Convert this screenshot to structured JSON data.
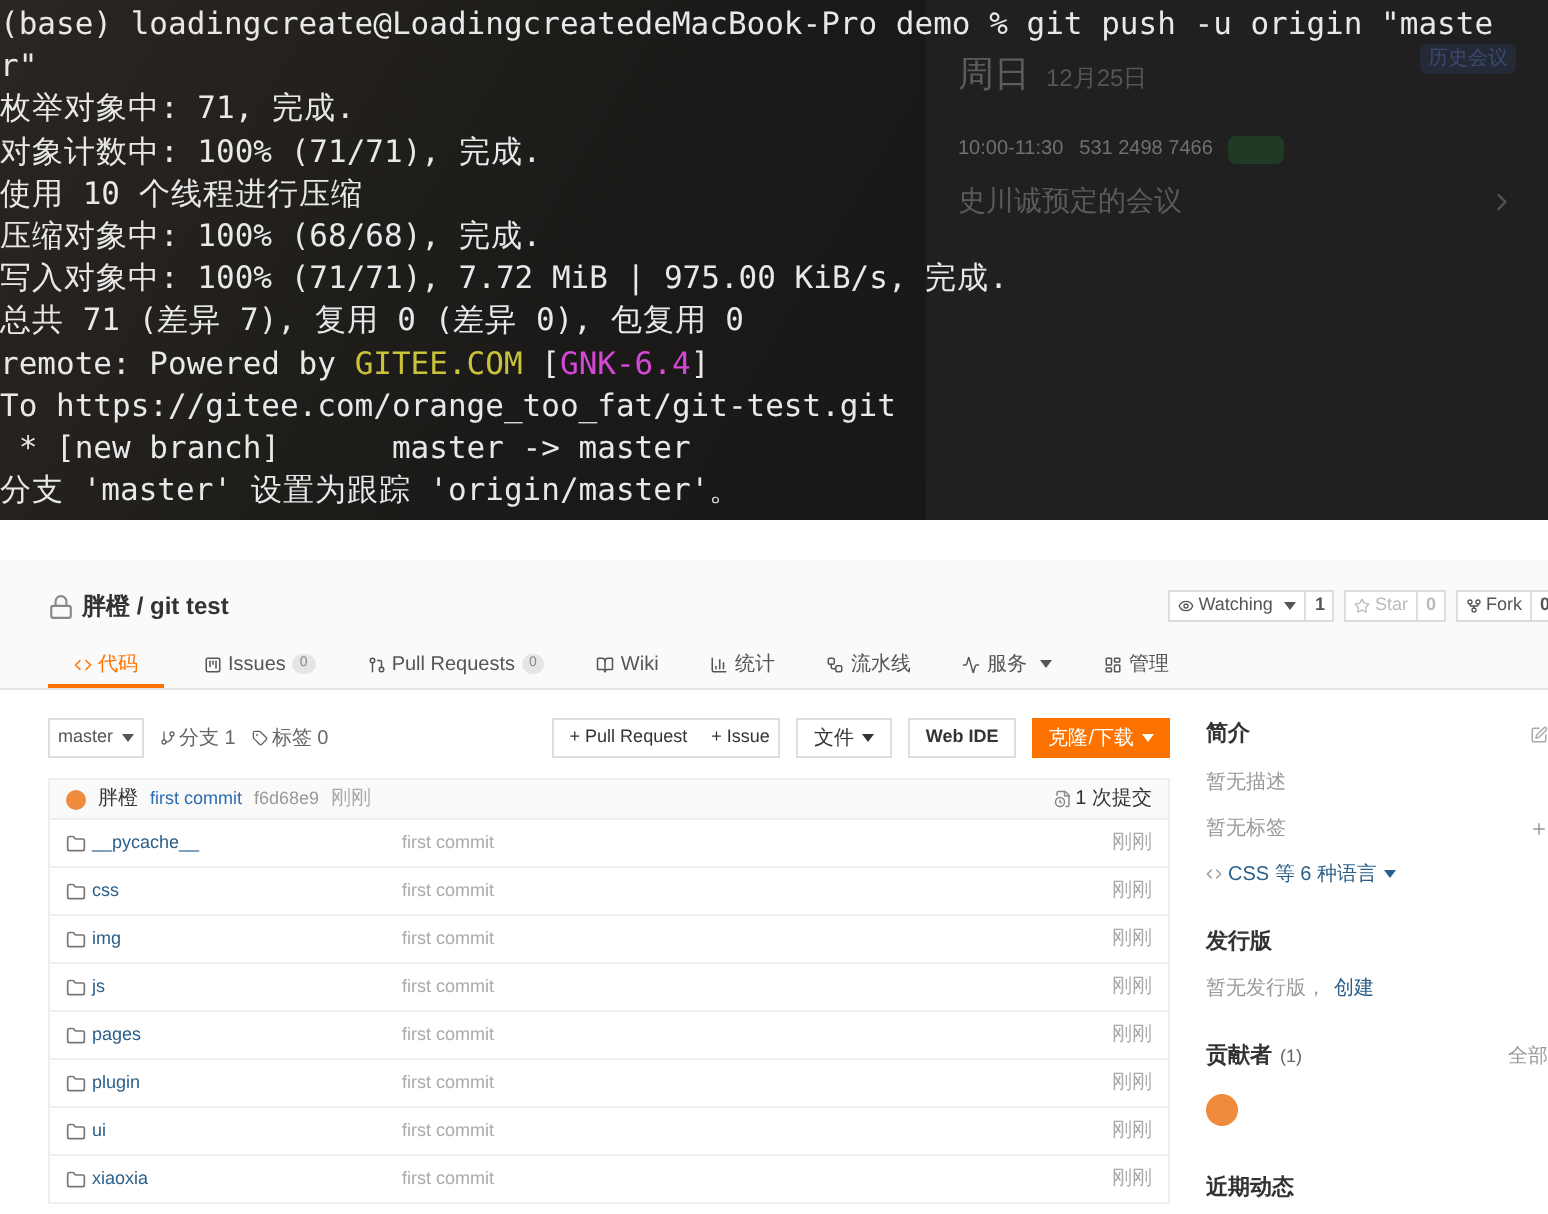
{
  "terminal": {
    "lines": [
      {
        "segments": [
          {
            "text": "(base) loadingcreate@LoadingcreatedeMacBook-Pro demo % git push -u origin \"maste",
            "color": "#e8e8e8"
          }
        ]
      },
      {
        "segments": [
          {
            "text": "r\"",
            "color": "#e8e8e8"
          }
        ]
      },
      {
        "segments": [
          {
            "text": "枚举对象中: 71, 完成.",
            "color": "#e8e8e8"
          }
        ]
      },
      {
        "segments": [
          {
            "text": "对象计数中: 100% (71/71), 完成.",
            "color": "#e8e8e8"
          }
        ]
      },
      {
        "segments": [
          {
            "text": "使用 10 个线程进行压缩",
            "color": "#e8e8e8"
          }
        ]
      },
      {
        "segments": [
          {
            "text": "压缩对象中: 100% (68/68), 完成.",
            "color": "#e8e8e8"
          }
        ]
      },
      {
        "segments": [
          {
            "text": "写入对象中: 100% (71/71), 7.72 MiB | 975.00 KiB/s, 完成.",
            "color": "#e8e8e8"
          }
        ]
      },
      {
        "segments": [
          {
            "text": "总共 71 (差异 7), 复用 0 (差异 0), 包复用 0",
            "color": "#e8e8e8"
          }
        ]
      },
      {
        "segments": [
          {
            "text": "remote: Powered by ",
            "color": "#e8e8e8"
          },
          {
            "text": "GITEE.COM",
            "color": "#c9c23a"
          },
          {
            "text": " [",
            "color": "#e8e8e8"
          },
          {
            "text": "GNK-6.4",
            "color": "#d548d5"
          },
          {
            "text": "]",
            "color": "#e8e8e8"
          }
        ]
      },
      {
        "segments": [
          {
            "text": "To https://gitee.com/orange_too_fat/git-test.git",
            "color": "#e8e8e8"
          }
        ]
      },
      {
        "segments": [
          {
            "text": " * [new branch]      master -> master",
            "color": "#e8e8e8"
          }
        ]
      },
      {
        "segments": [
          {
            "text": "分支 'master' 设置为跟踪 'origin/master'。",
            "color": "#e8e8e8"
          }
        ]
      }
    ]
  },
  "calendar_overlay": {
    "day": "周日",
    "date": "12月25日",
    "history_button": "历史会议",
    "time": "10:00-11:30",
    "meeting_id": "531 2498 7466",
    "title": "史川诚预定的会议"
  },
  "repo": {
    "title": "胖橙 / git test",
    "actions": [
      {
        "label": "Watching",
        "count": "1"
      },
      {
        "label": "Star",
        "count": "0"
      },
      {
        "label": "Fork",
        "count": "0"
      }
    ],
    "tabs": [
      {
        "label": "代码",
        "selected": true
      },
      {
        "label": "Issues",
        "count": "0",
        "selected": false
      },
      {
        "label": "Pull Requests",
        "count": "0",
        "selected": false
      },
      {
        "label": "Wiki",
        "selected": false
      },
      {
        "label": "统计",
        "selected": false
      },
      {
        "label": "流水线",
        "selected": false
      },
      {
        "label": "服务",
        "selected": false
      },
      {
        "label": "管理",
        "selected": false
      }
    ],
    "branch": "master",
    "branches": "分支 1",
    "tags": "标签 0",
    "toolbar": {
      "pull_request": "+ Pull Request",
      "issue": "+ Issue",
      "file": "文件",
      "web_ide": "Web IDE",
      "clone": "克隆/下载"
    },
    "commit": {
      "author": "胖橙",
      "message": "first commit",
      "hash": "f6d68e9",
      "time": "刚刚",
      "count": "1 次提交"
    },
    "files": [
      {
        "name": "__pycache__",
        "message": "first commit",
        "time": "刚刚"
      },
      {
        "name": "css",
        "message": "first commit",
        "time": "刚刚"
      },
      {
        "name": "img",
        "message": "first commit",
        "time": "刚刚"
      },
      {
        "name": "js",
        "message": "first commit",
        "time": "刚刚"
      },
      {
        "name": "pages",
        "message": "first commit",
        "time": "刚刚"
      },
      {
        "name": "plugin",
        "message": "first commit",
        "time": "刚刚"
      },
      {
        "name": "ui",
        "message": "first commit",
        "time": "刚刚"
      },
      {
        "name": "xiaoxia",
        "message": "first commit",
        "time": "刚刚"
      }
    ],
    "sidebar": {
      "intro_title": "简介",
      "no_description": "暂无描述",
      "no_tags": "暂无标签",
      "languages": "CSS 等 6 种语言",
      "releases_title": "发行版",
      "no_releases": "暂无发行版，",
      "create_link": "创建",
      "contributors_title": "贡献者",
      "contributors_count": "(1)",
      "all_link": "全部",
      "activity_title": "近期动态"
    }
  }
}
